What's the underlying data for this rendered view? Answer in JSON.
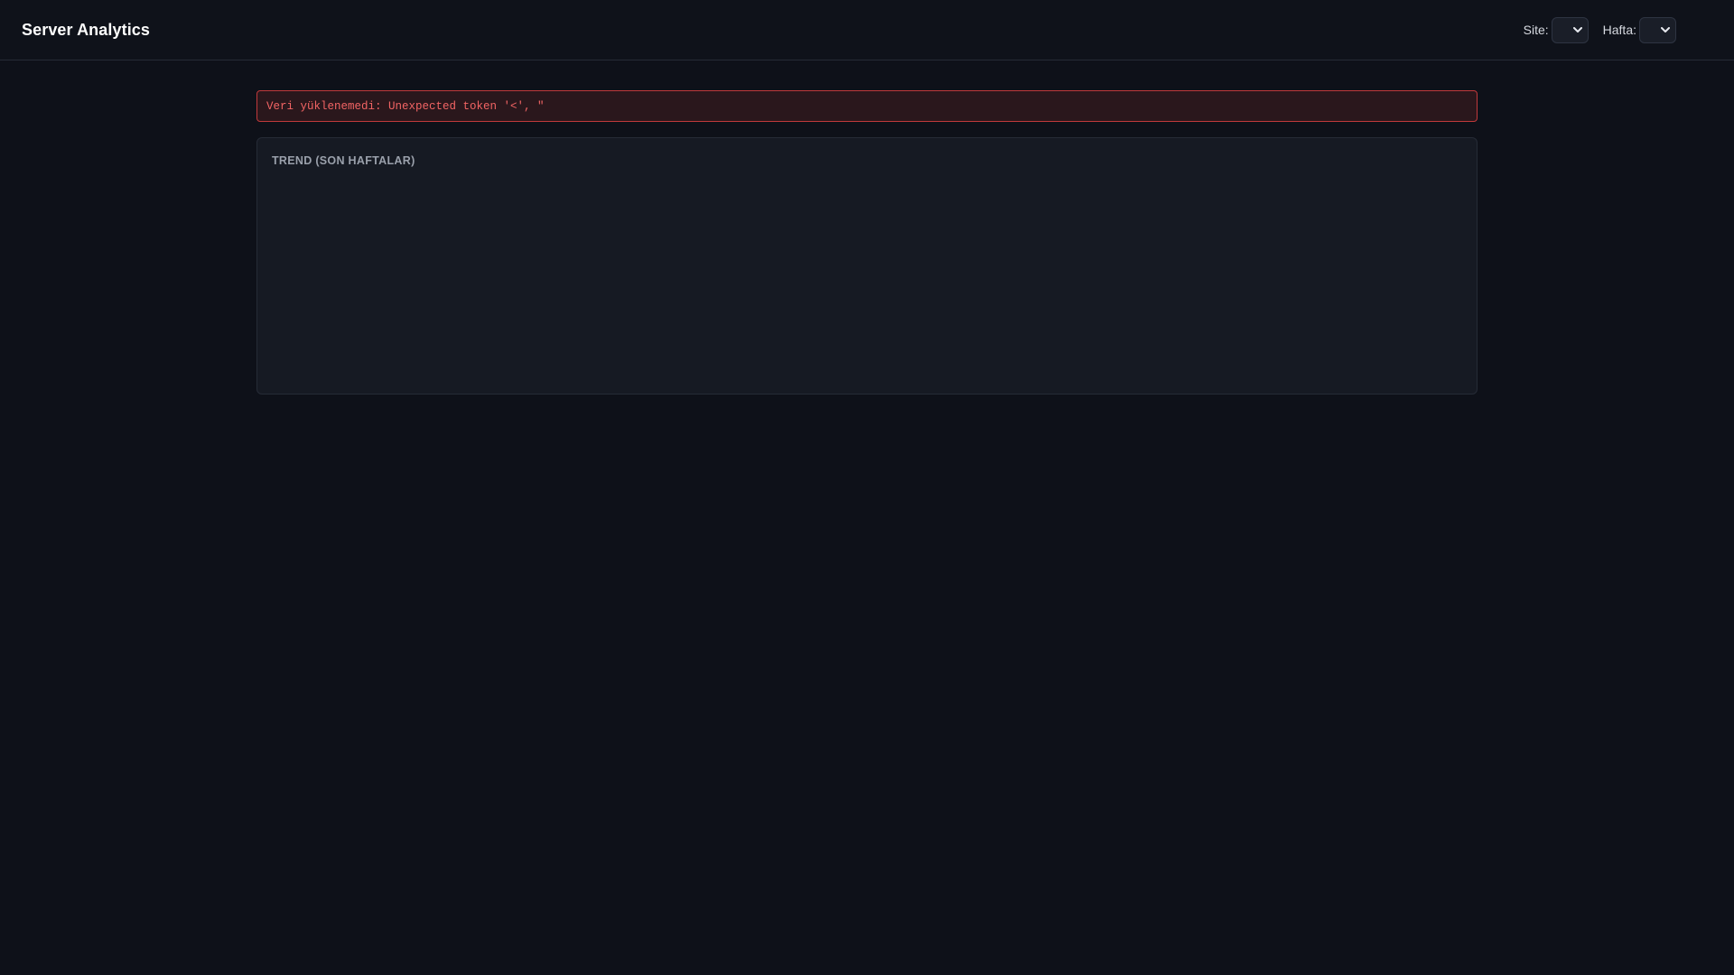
{
  "header": {
    "title": "Server Analytics",
    "filters": {
      "site_label": "Site:",
      "site_value": "",
      "week_label": "Hafta:",
      "week_value": ""
    }
  },
  "error": {
    "message": "Veri yüklenemedi: Unexpected token '<', \""
  },
  "trend_card": {
    "title": "TREND (SON HAFTALAR)"
  },
  "colors": {
    "background": "#0e1119",
    "card": "#161a23",
    "error_border": "#c0393b",
    "error_text": "#f26464"
  },
  "icons": {
    "select_arrow": "chevron-down-icon"
  }
}
